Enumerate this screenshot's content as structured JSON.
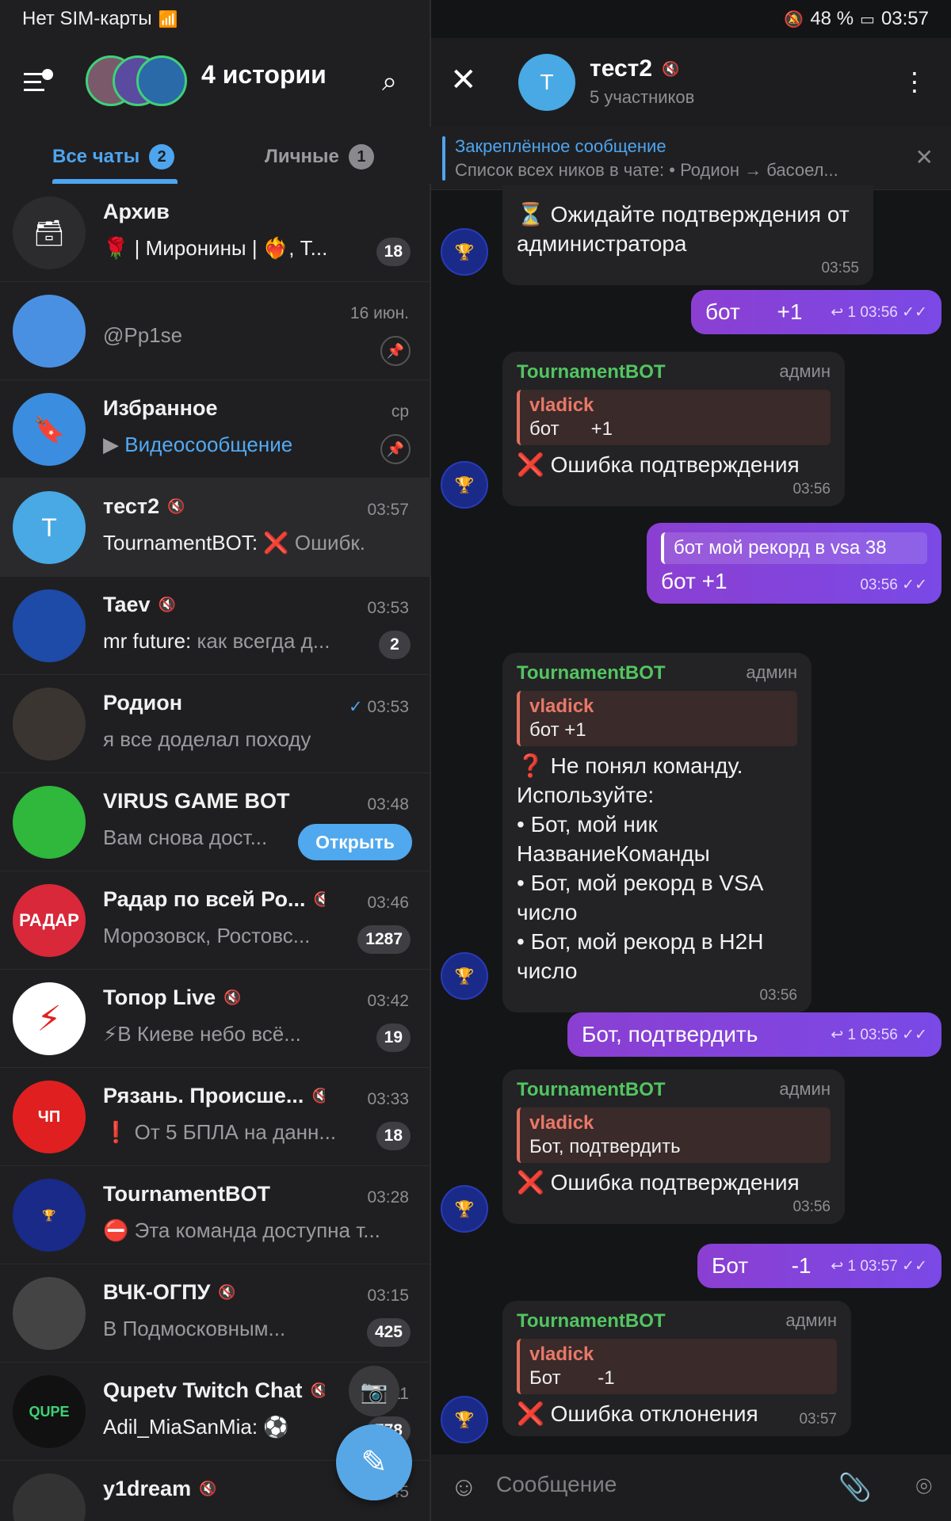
{
  "status": {
    "left": "Нет SIM-карты",
    "battery": "48 %",
    "time": "03:57"
  },
  "header": {
    "stories_title": "4 истории"
  },
  "tabs": [
    {
      "label": "Все чаты",
      "count": "2"
    },
    {
      "label": "Личные",
      "count": "1"
    }
  ],
  "chats": [
    {
      "name": "Архив",
      "time": "",
      "preview_emoji": "🌹",
      "preview": "| Миронины | ❤️‍🔥, Т...",
      "badge": "18",
      "color": "#2c2c2e"
    },
    {
      "name": "",
      "time": "16 июн.",
      "preview": "@Pp1se",
      "pinned": true,
      "color": "#4a90e2"
    },
    {
      "name": "Избранное",
      "time": "ср",
      "preview": "Видеосообщение",
      "pinned": true,
      "color": "#3b8de0"
    },
    {
      "name": "тест2",
      "time": "03:57",
      "sender": "TournamentBOT:",
      "preview": "❌ Ошибк...",
      "letter": "T",
      "color": "#48a9e4"
    },
    {
      "name": "Taev",
      "time": "03:53",
      "sender": "mr future:",
      "preview": "как всегда д...",
      "badge": "2",
      "color": "#1e4aa8"
    },
    {
      "name": "Родион",
      "time": "03:53",
      "preview": "я все доделал походу",
      "color": "#3a3530"
    },
    {
      "name": "VIRUS GAME BOT",
      "time": "03:48",
      "preview": "Вам снова дост...",
      "button": "Открыть",
      "color": "#2fb83c"
    },
    {
      "name": "Радар по всей Ро...",
      "time": "03:46",
      "preview": "Морозовск, Ростовс...",
      "badge": "1287",
      "color": "#d8283a"
    },
    {
      "name": "Топор Live",
      "time": "03:42",
      "preview": "⚡В Киеве небо всё...",
      "badge": "19",
      "color": "#ffffff"
    },
    {
      "name": "Рязань. Происше...",
      "time": "03:33",
      "preview": "❗ От 5 БПЛА на данн...",
      "badge": "18",
      "color": "#e02020"
    },
    {
      "name": "TournamentBOT",
      "time": "03:28",
      "preview": "⛔ Эта команда доступна т...",
      "color": "#1a2a88"
    },
    {
      "name": "ВЧК-ОГПУ",
      "time": "03:15",
      "preview": "В Подмосковным...",
      "badge": "425",
      "color": "#444"
    },
    {
      "name": "Qupetv Twitch Chat",
      "time": "...11",
      "sender": "Adil_MiaSanMia:",
      "preview": "⚽",
      "badge": "778",
      "color": "#111"
    },
    {
      "name": "y1dream",
      "time": "...45",
      "preview": "",
      "color": "#333"
    }
  ],
  "chat": {
    "title": "тест2",
    "subtitle": "5 участников",
    "avatar_letter": "T",
    "pinned_title": "Закреплённое сообщение",
    "pinned_text": "Список всех ников в чате:  • Родион → басоел...",
    "input_placeholder": "Сообщение",
    "messages": {
      "m1_text": "⏳ Ожидайте подтверждения от администратора",
      "m1_time": "03:55",
      "m2_text": "бот      +1",
      "m2_meta": "↩ 1  03:56 ✓✓",
      "m3_sender": "TournamentBOT",
      "m3_admin": "админ",
      "m3_qn": "vladick",
      "m3_qt": "бот      +1",
      "m3_text": "❌ Ошибка подтверждения",
      "m3_time": "03:56",
      "m4_reply": "бот мой рекорд в vsa 38",
      "m4_text": "бот +1",
      "m4_meta": "03:56 ✓✓",
      "m5_sender": "TournamentBOT",
      "m5_admin": "админ",
      "m5_qn": "vladick",
      "m5_qt": "бот +1",
      "m5_text": "❓ Не понял команду.\nИспользуйте:\n• Бот, мой ник НазваниеКоманды\n• Бот, мой рекорд в VSA число\n• Бот, мой рекорд в H2H число",
      "m5_time": "03:56",
      "m6_text": "Бот, подтвердить",
      "m6_meta": "↩ 1  03:56 ✓✓",
      "m7_sender": "TournamentBOT",
      "m7_admin": "админ",
      "m7_qn": "vladick",
      "m7_qt": "Бот, подтвердить",
      "m7_text": "❌ Ошибка подтверждения",
      "m7_time": "03:56",
      "m8_text": "Бот       -1",
      "m8_meta": "↩ 1  03:57 ✓✓",
      "m9_sender": "TournamentBOT",
      "m9_admin": "админ",
      "m9_qn": "vladick",
      "m9_qt": "Бот       -1",
      "m9_text": "❌ Ошибка отклонения",
      "m9_time": "03:57"
    }
  }
}
